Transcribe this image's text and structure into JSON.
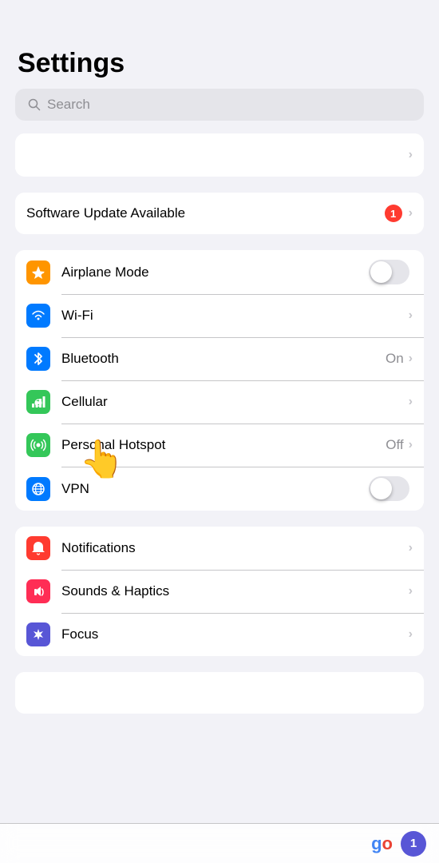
{
  "page": {
    "title": "Settings",
    "background": "#f2f2f7"
  },
  "search": {
    "placeholder": "Search"
  },
  "sections": {
    "empty_section": {
      "rows": [
        {
          "id": "apple-id",
          "label": "",
          "hasChevron": true
        }
      ]
    },
    "update_section": {
      "rows": [
        {
          "id": "software-update",
          "label": "Software Update Available",
          "badgeCount": "1",
          "hasChevron": true
        }
      ]
    },
    "connectivity_section": {
      "rows": [
        {
          "id": "airplane-mode",
          "label": "Airplane Mode",
          "hasToggle": true,
          "toggleOn": false,
          "iconColor": "orange",
          "iconType": "airplane"
        },
        {
          "id": "wifi",
          "label": "Wi-Fi",
          "hasChevron": true,
          "iconColor": "blue",
          "iconType": "wifi"
        },
        {
          "id": "bluetooth",
          "label": "Bluetooth",
          "value": "On",
          "hasChevron": true,
          "iconColor": "blue",
          "iconType": "bluetooth"
        },
        {
          "id": "cellular",
          "label": "Cellular",
          "hasChevron": true,
          "iconColor": "green",
          "iconType": "cellular"
        },
        {
          "id": "personal-hotspot",
          "label": "Personal Hotspot",
          "value": "Off",
          "hasChevron": true,
          "iconColor": "green",
          "iconType": "hotspot"
        },
        {
          "id": "vpn",
          "label": "VPN",
          "hasToggle": true,
          "toggleOn": false,
          "iconColor": "blue",
          "iconType": "vpn"
        }
      ]
    },
    "system_section": {
      "rows": [
        {
          "id": "notifications",
          "label": "Notifications",
          "hasChevron": true,
          "iconColor": "red",
          "iconType": "notifications"
        },
        {
          "id": "sounds-haptics",
          "label": "Sounds & Haptics",
          "hasChevron": true,
          "iconColor": "red-pink",
          "iconType": "sounds"
        },
        {
          "id": "focus",
          "label": "Focus",
          "hasChevron": true,
          "iconColor": "purple",
          "iconType": "focus"
        }
      ]
    }
  },
  "bottom_bar": {
    "go_label": "go",
    "badge_count": "1"
  },
  "cursor": {
    "emoji": "👆"
  }
}
